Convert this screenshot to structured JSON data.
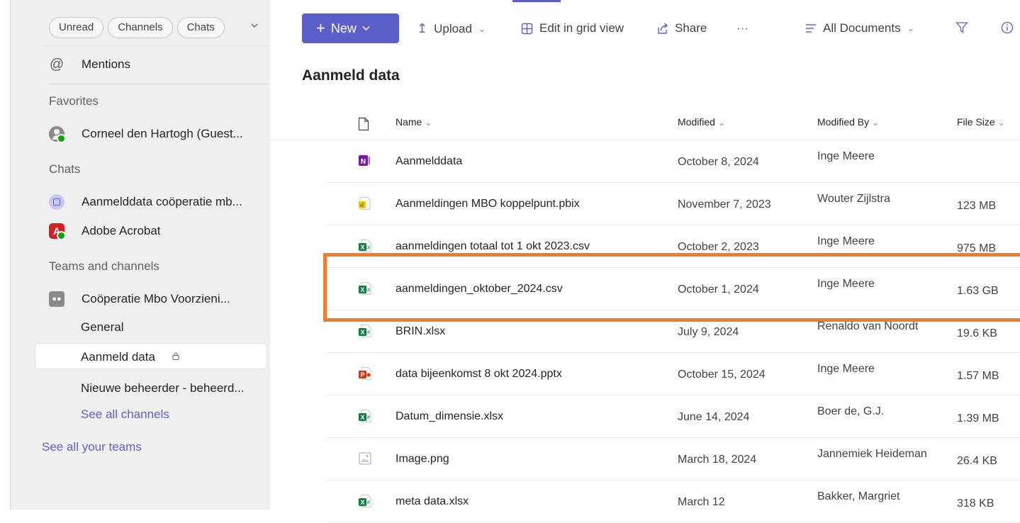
{
  "sidebar": {
    "filters": [
      "Unread",
      "Channels",
      "Chats"
    ],
    "mentions": "Mentions",
    "favorites_label": "Favorites",
    "favorite_contact": "Corneel den Hartogh (Guest...",
    "chats_label": "Chats",
    "chats": [
      "Aanmelddata coöperatie mb...",
      "Adobe Acrobat"
    ],
    "teams_label": "Teams and channels",
    "team_name": "Coöperatie Mbo Voorzieni...",
    "channels": [
      "General",
      "Aanmeld data",
      "Nieuwe beheerder - beheerd..."
    ],
    "see_all_channels": "See all channels",
    "see_all_teams": "See all your teams"
  },
  "toolbar": {
    "new_label": "New",
    "upload_label": "Upload",
    "grid_label": "Edit in grid view",
    "share_label": "Share",
    "more_label": "···",
    "view_label": "All Documents"
  },
  "library_title": "Aanmeld data",
  "columns": {
    "name": "Name",
    "modified": "Modified",
    "modified_by": "Modified By",
    "file_size": "File Size"
  },
  "files": [
    {
      "name": "Aanmelddata",
      "modified": "October 8, 2024",
      "by": "Inge Meere",
      "size": "",
      "type": "onenote"
    },
    {
      "name": "Aanmeldingen MBO koppelpunt.pbix",
      "modified": "November 7, 2023",
      "by": "Wouter Zijlstra",
      "size": "123 MB",
      "type": "pbix"
    },
    {
      "name": "aanmeldingen totaal tot 1 okt 2023.csv",
      "modified": "October 2, 2023",
      "by": "Inge Meere",
      "size": "975 MB",
      "type": "csv"
    },
    {
      "name": "aanmeldingen_oktober_2024.csv",
      "modified": "October 1, 2024",
      "by": "Inge Meere",
      "size": "1.63 GB",
      "type": "csv"
    },
    {
      "name": "BRIN.xlsx",
      "modified": "July 9, 2024",
      "by": "Renaldo van Noordt",
      "size": "19.6 KB",
      "type": "xlsx"
    },
    {
      "name": "data bijeenkomst 8 okt 2024.pptx",
      "modified": "October 15, 2024",
      "by": "Inge Meere",
      "size": "1.57 MB",
      "type": "pptx"
    },
    {
      "name": "Datum_dimensie.xlsx",
      "modified": "June 14, 2024",
      "by": "Boer de, G.J.",
      "size": "1.39 MB",
      "type": "xlsx"
    },
    {
      "name": "Image.png",
      "modified": "March 18, 2024",
      "by": "Jannemiek Heideman",
      "size": "26.4 KB",
      "type": "image"
    },
    {
      "name": "meta data.xlsx",
      "modified": "March 12",
      "by": "Bakker, Margriet",
      "size": "318 KB",
      "type": "xlsx"
    }
  ],
  "colors": {
    "accent": "#5b5fc7",
    "highlight": "#ee7d31",
    "excel": "#107c41",
    "powerpoint": "#c43e1c",
    "onenote": "#7719aa",
    "powerbi": "#f2c811"
  }
}
